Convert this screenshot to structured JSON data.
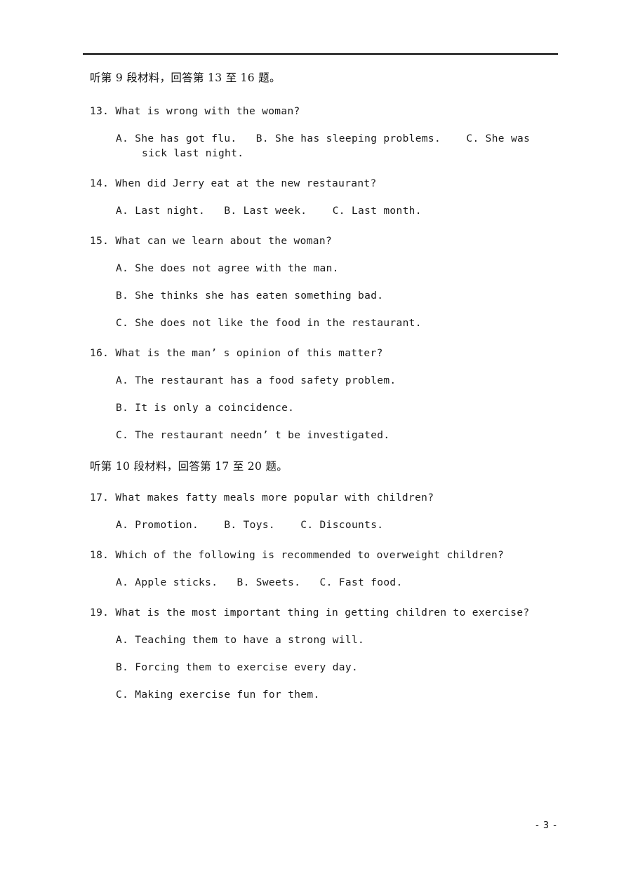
{
  "page": {
    "number_label": "- 3 -"
  },
  "sections": [
    {
      "heading": "听第 9 段材料，回答第 13 至 16 题。",
      "questions": [
        {
          "stem": "13. What is wrong with the woman?",
          "options_inline": "A. She has got flu.   B. She has sleeping problems.    C. She was sick last night.",
          "layout": "inline"
        },
        {
          "stem": "14. When did Jerry eat at the new restaurant?",
          "options_inline": "A. Last night.   B. Last week.    C. Last month.",
          "layout": "inline"
        },
        {
          "stem": "15. What can we learn about the woman?",
          "layout": "stacked",
          "options": [
            "A. She does not agree with the man.",
            "B. She thinks she has eaten something bad.",
            "C. She does not like the food in the restaurant."
          ]
        },
        {
          "stem": "16. What is the man’ s opinion of this matter?",
          "layout": "stacked",
          "options": [
            "A. The restaurant has a food safety problem.",
            "B. It is only a coincidence.",
            "C. The restaurant needn’ t be investigated."
          ]
        }
      ]
    },
    {
      "heading": "听第 10 段材料，回答第 17 至 20 题。",
      "questions": [
        {
          "stem": "17. What makes fatty meals more popular with children?",
          "options_inline": "A. Promotion.    B. Toys.    C. Discounts.",
          "layout": "inline"
        },
        {
          "stem": "18. Which of the following is recommended to overweight children?",
          "options_inline": "A. Apple sticks.   B. Sweets.   C. Fast food.",
          "layout": "inline"
        },
        {
          "stem": "19. What is the most important thing in getting children to exercise?",
          "layout": "stacked",
          "options": [
            "A. Teaching them to have a strong will.",
            "B. Forcing them to exercise every day.",
            "C. Making exercise fun for them."
          ]
        }
      ]
    }
  ]
}
